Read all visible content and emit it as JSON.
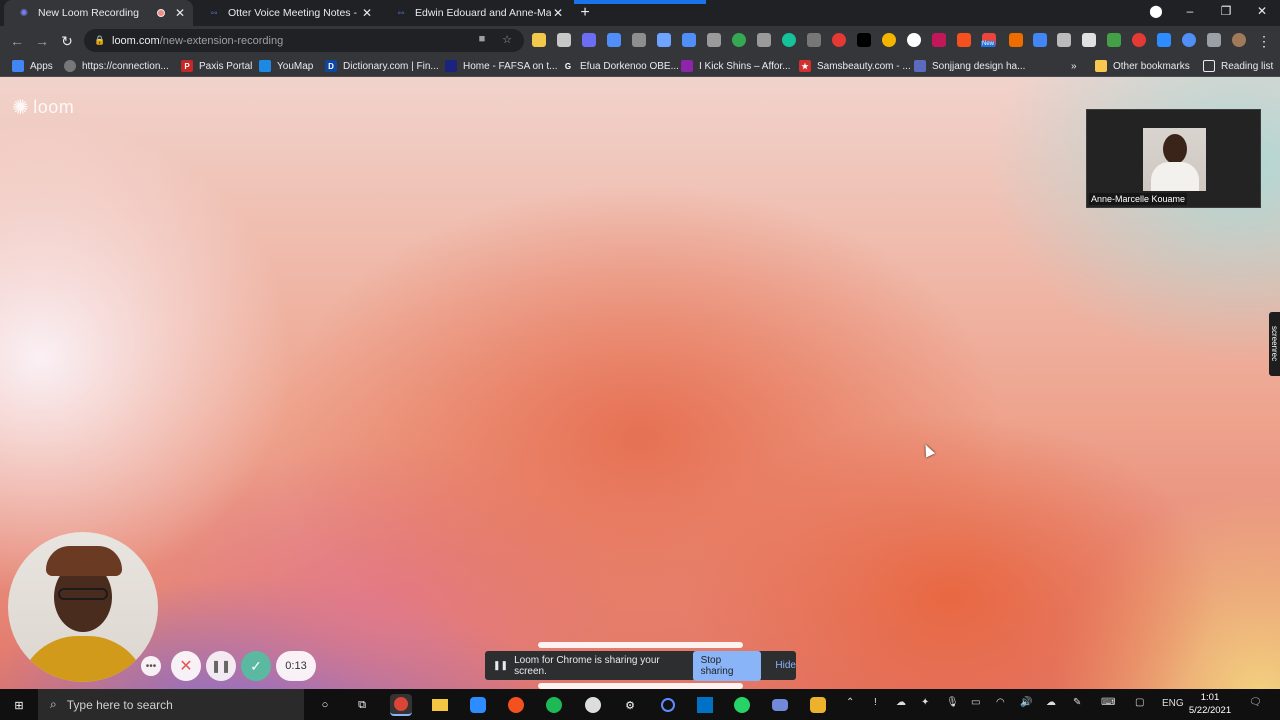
{
  "browser": {
    "tabs": [
      {
        "title": "New Loom Recording",
        "active": true,
        "recording": true
      },
      {
        "title": "Otter Voice Meeting Notes - Otte",
        "active": false
      },
      {
        "title": "Edwin Edouard and Anne-Marcel",
        "active": false
      }
    ],
    "url_host": "loom.com",
    "url_path": "/new-extension-recording",
    "bookmarks": [
      "Apps",
      "https://connection...",
      "Paxis Portal",
      "YouMap",
      "Dictionary.com | Fin...",
      "Home - FAFSA on t...",
      "Efua Dorkenoo OBE...",
      "I Kick Shins – Affor...",
      "Samsbeauty.com - ...",
      "Sonjjang design ha...",
      "Other bookmarks",
      "Reading list"
    ],
    "overflow_label": "»",
    "new_badge": "New"
  },
  "page": {
    "logo_text": "loom",
    "participant_name": "Anne-Marcelle Kouame",
    "screenrec_label": "screenrec",
    "timer": "0:13",
    "share_message": "Loom for Chrome is sharing your screen.",
    "stop_sharing": "Stop sharing",
    "hide": "Hide"
  },
  "taskbar": {
    "search_placeholder": "Type here to search",
    "language": "ENG",
    "time": "1:01",
    "date": "5/22/2021"
  },
  "colors": {
    "accent": "#1a73e8",
    "stop_button": "#8ab4f8",
    "done_button": "#5bb8a1"
  }
}
